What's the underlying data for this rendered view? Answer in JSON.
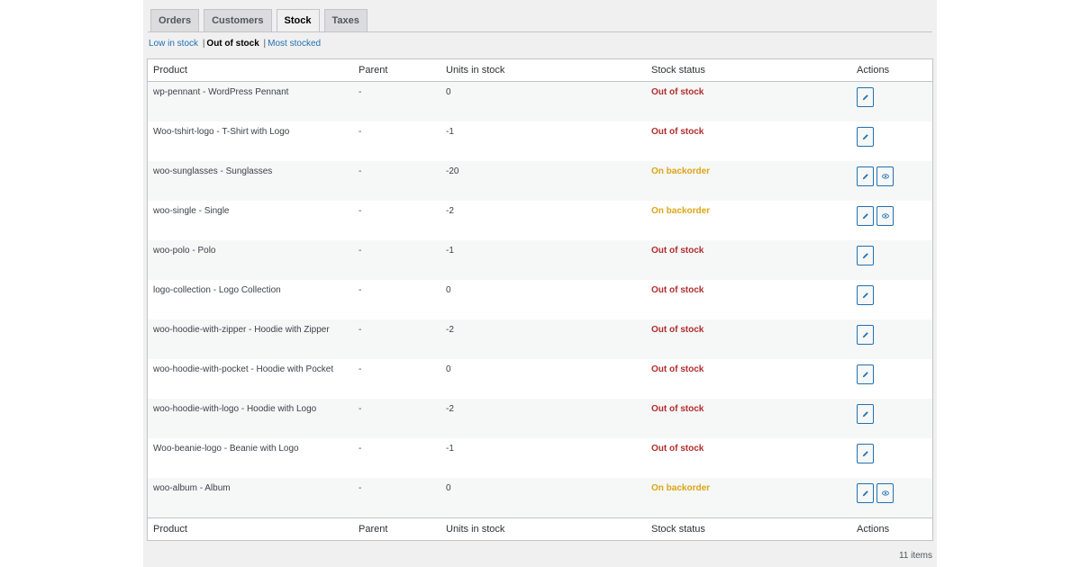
{
  "tabs": [
    {
      "label": "Orders",
      "active": false
    },
    {
      "label": "Customers",
      "active": false
    },
    {
      "label": "Stock",
      "active": true
    },
    {
      "label": "Taxes",
      "active": false
    }
  ],
  "filters": {
    "low_in_stock": "Low in stock",
    "separator": "|",
    "out_of_stock": "Out of stock",
    "most_stocked": "Most stocked"
  },
  "table": {
    "headers": {
      "product": "Product",
      "parent": "Parent",
      "units": "Units in stock",
      "status": "Stock status",
      "actions": "Actions"
    },
    "rows": [
      {
        "product": "wp-pennant - WordPress Pennant",
        "parent": "-",
        "units": "0",
        "status": "Out of stock",
        "status_type": "out",
        "view": false
      },
      {
        "product": "Woo-tshirt-logo - T-Shirt with Logo",
        "parent": "-",
        "units": "-1",
        "status": "Out of stock",
        "status_type": "out",
        "view": false
      },
      {
        "product": "woo-sunglasses - Sunglasses",
        "parent": "-",
        "units": "-20",
        "status": "On backorder",
        "status_type": "back",
        "view": true
      },
      {
        "product": "woo-single - Single",
        "parent": "-",
        "units": "-2",
        "status": "On backorder",
        "status_type": "back",
        "view": true
      },
      {
        "product": "woo-polo - Polo",
        "parent": "-",
        "units": "-1",
        "status": "Out of stock",
        "status_type": "out",
        "view": false
      },
      {
        "product": "logo-collection - Logo Collection",
        "parent": "-",
        "units": "0",
        "status": "Out of stock",
        "status_type": "out",
        "view": false
      },
      {
        "product": "woo-hoodie-with-zipper - Hoodie with Zipper",
        "parent": "-",
        "units": "-2",
        "status": "Out of stock",
        "status_type": "out",
        "view": false
      },
      {
        "product": "woo-hoodie-with-pocket - Hoodie with Pocket",
        "parent": "-",
        "units": "0",
        "status": "Out of stock",
        "status_type": "out",
        "view": false
      },
      {
        "product": "woo-hoodie-with-logo - Hoodie with Logo",
        "parent": "-",
        "units": "-2",
        "status": "Out of stock",
        "status_type": "out",
        "view": false
      },
      {
        "product": "Woo-beanie-logo - Beanie with Logo",
        "parent": "-",
        "units": "-1",
        "status": "Out of stock",
        "status_type": "out",
        "view": false
      },
      {
        "product": "woo-album - Album",
        "parent": "-",
        "units": "0",
        "status": "On backorder",
        "status_type": "back",
        "view": true
      }
    ]
  },
  "item_count": "11 items",
  "colors": {
    "out_of_stock": "#b32d2e",
    "on_backorder": "#dba617",
    "link": "#2271b1"
  },
  "icons": {
    "edit": "pencil-icon",
    "view": "eye-icon"
  }
}
